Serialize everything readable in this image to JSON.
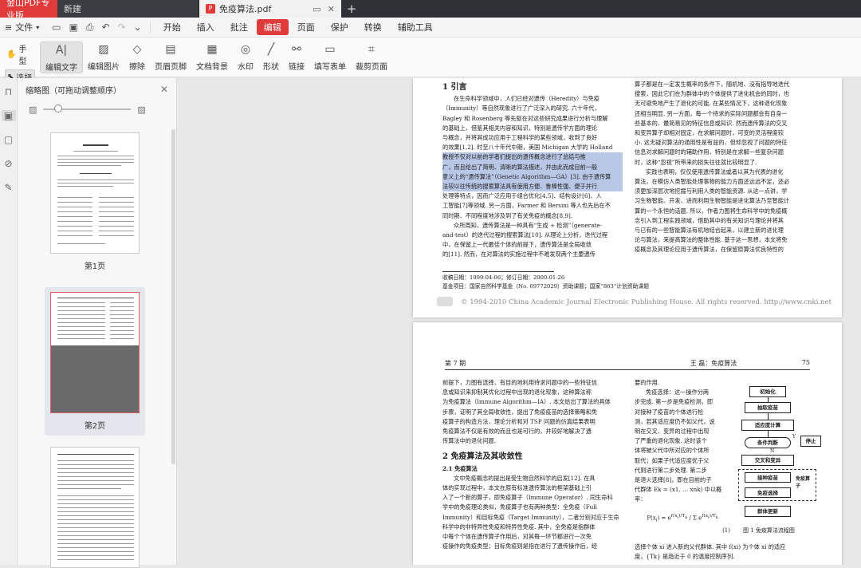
{
  "tabs": {
    "brand": "金山PDF专业版",
    "new": "新建",
    "doc": "免疫算法.pdf"
  },
  "menu": {
    "file": "文件",
    "items": [
      "开始",
      "插入",
      "批注",
      "编辑",
      "页面",
      "保护",
      "转换",
      "辅助工具"
    ],
    "active": "编辑"
  },
  "toolbar": {
    "hand": "手型",
    "select": "选择",
    "tools": [
      "编辑文字",
      "编辑图片",
      "擦除",
      "页眉页脚",
      "文档背景",
      "水印",
      "形状",
      "链接",
      "填写表单",
      "裁剪页面"
    ]
  },
  "thumbnails": {
    "title": "缩略图（可拖动调整顺序）",
    "pages": [
      "第1页",
      "第2页"
    ]
  },
  "page1": {
    "heading": "1   引言",
    "left": [
      "在生命科学领域中，人们已经对遗传（Heredity）与免疫",
      "（Immunity）等自然现象进行了广泛深入的研究. 六十年代，",
      "Bagley 和 Rosenberg 等先驱在对这些研究成果进行分析与理解",
      "的基础上，借鉴其相关内容和知识，特别是遗传学方面的理论",
      "与概念，并将其成功应用于工程科学的某些领域，收到了良好",
      "的效果[1,2]. 时至八十年代中期，美国 Michigan 大学的 Holland",
      "教授不仅对以前的学者们提出的遗传概念进行了总结与推",
      "广，而且给出了简明、清晰的算法描述，并由此而成目前一般",
      "意义上的“遗传算法”（Genetic Algorithm—GA）[3]. 由于遗传算",
      "法较以往传统的搜索算法具有使用方便、鲁棒性强、便于并行",
      "处理等特点，因而广泛应用于组合优化[4,5]、结构设计[6]、人",
      "工智能[7]等领域. 另一方面，Farmer 和 Bersini 等人也先后在不",
      "同时期、不同程度地涉及到了有关免疫的概念[8,9].",
      "众所周知，遗传算法是一种具有“生成 + 检测”（generate-",
      "and-test）的迭代过程的搜索算法[10]. 从理论上分析，迭代过程",
      "中，在保留上一代最佳个体的前提下，遗传算法是全局收敛",
      "的[11]. 然而，在对算法的实施过程中不难发现两个主要遗传"
    ],
    "right": [
      "算子都是在一定发生概率的条件下，随机地、没有指导地迭代",
      "搜索，因此它们在为群体中的个体提供了进化机会的同时，也",
      "无可避免地产生了退化的可能. 在某些情况下，这种退化现象",
      "还相当明显. 另一方面，每一个待求的实际问题都会有自身一",
      "些基本的、最简易见的特征信息或知识. 然而遗传算法的交叉",
      "和变异算子却相对固定，在求解问题时，可变的灵活程度较",
      "小. 这无疑对算法的通用性是有益的，但却忽视了问题的特征",
      "信息对求解问题时的辅助作用，特别是在求解一些复杂问题",
      "时，这种“忽视”所带来的损失往往就比较明显了.",
      "实践也表明，仅仅使用遗传算法或者以其为代表的进化",
      "算法，在模仿人类智能处理事物的能力方面还远远不足，还必",
      "须更加深层次地挖掘与利用人类的智能资源. 从这一点讲，学",
      "习生物智能、开发、进而利用生物智能是进化算法乃至智能计",
      "算的一个永恒的话题. 所以，作者力图将生命科学中的免疫概",
      "念引入到工程实践领域，借助其中的有关知识与理论并将其",
      "与已有的一些智能算法有机地结合起来，以建立新的进化理",
      "论与算法，来提高算法的整体性能. 基于这一思想，本文将免",
      "疫概念及其理论应用于遗传算法，在保留原算法优良特性的"
    ],
    "footnote1": "收稿日期：1999-04-06；修订日期：2000-01-26",
    "footnote2": "基金项目：国家自然科学基金（No. 69772029）资助课题；国家“863”计划资助课题",
    "copyright": "© 1994-2010 China Academic Journal Electronic Publishing House. All rights reserved.    http://www.cnki.net"
  },
  "page2": {
    "issue": "第  7  期",
    "author": "王   磊：免疫算法",
    "pagenum": "75",
    "left": [
      "前提下，力图有选择、有目的地利用待求问题中的一些特征信",
      "息或知识来抑制其优化过程中出现的退化现象，这种算法称",
      "为免疫算法（Immune Algorithm—IA）. 本文给出了算法的具体",
      "步骤，证明了其全局收敛性，提出了免疫疫苗的选择策略和免",
      "疫算子的构造方法，理论分析和对 TSP 问题的仿真结果表明",
      "免疫算法不仅是有效的而且也是可行的，并较好地解决了遗",
      "传算法中的退化问题."
    ],
    "heading": "2   免疫算法及其收敛性",
    "sub": "2.1   免疫算法",
    "left2": [
      "文中免疫概念的提出是受生物自然科学的启发[12]. 在具",
      "体的实现过程中，本文在原有标准遗传算法的框架基础上引",
      "入了一个新的算子，即免疫算子（Immune Operator）. 同生命科",
      "学中的免疫理论类似，免疫算子也有两种类型：全免疫（Full",
      "Immunity）和目标免疫（Target Immunity），二者分别对应于生命",
      "科学中的非特异性免疫和特异性免疫. 其中，全免疫是指群体",
      "中每个个体在遗传算子作用后，对其每一环节都进行一次免",
      "疫操作的免疫类型；目标免疫则是指在进行了遗传操作后，经"
    ],
    "mid": [
      "要的作用.",
      "免疫选择：这一操作分两",
      "步完成. 第一步是免疫检测，即",
      "对接种了疫苗的个体进行检",
      "测，若其适应度仍不如父代，说",
      "明在交叉、变异的过程中出现",
      "了严重的退化现象. 这时该个",
      "体将被父代中所对应的个体所",
      "取代；如果子代适应度优于父",
      "代则进行第二步处理. 第二步",
      "是退火选择[8]，即在目前的子",
      "代群体 Ek = (x1, … xnk) 中以概",
      "率："
    ],
    "bottom": [
      "选择个体 xi 进入新的父代群体. 其中 f(xi) 为个体 xi 的适应",
      "度，{Tk} 是趋近于 0 的温度控制序列."
    ],
    "flow": [
      "初始化",
      "抽取疫苗",
      "适应度计算",
      "条件判断",
      "停止",
      "交叉和变异",
      "接种疫苗",
      "免疫选择",
      "群体更新",
      "免疫算子"
    ],
    "flow_labels": [
      "Y",
      "N"
    ],
    "figcap": "图 1   免疫算法流程图",
    "formula_num": "(1)"
  }
}
